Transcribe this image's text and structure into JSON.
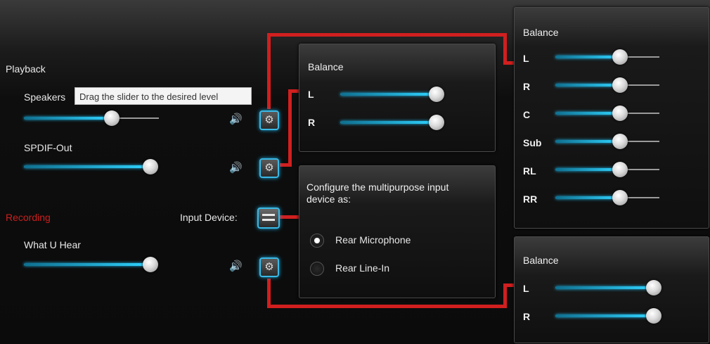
{
  "playback": {
    "title": "Playback",
    "devices": [
      {
        "label": "Speakers",
        "level": 0.65
      },
      {
        "label": "SPDIF-Out",
        "level": 1.0
      }
    ]
  },
  "recording": {
    "title": "Recording",
    "devices": [
      {
        "label": "What U Hear",
        "level": 1.0
      }
    ],
    "input_device_label": "Input Device:"
  },
  "tooltip": "Drag the slider to the desired level",
  "balance_small": {
    "title": "Balance",
    "channels": [
      {
        "label": "L",
        "level": 1.0
      },
      {
        "label": "R",
        "level": 1.0
      }
    ]
  },
  "balance_surround": {
    "title": "Balance",
    "channels": [
      {
        "label": "L",
        "level": 0.62
      },
      {
        "label": "R",
        "level": 0.62
      },
      {
        "label": "C",
        "level": 0.62
      },
      {
        "label": "Sub",
        "level": 0.62
      },
      {
        "label": "RL",
        "level": 0.62
      },
      {
        "label": "RR",
        "level": 0.62
      }
    ]
  },
  "balance_recording": {
    "title": "Balance",
    "channels": [
      {
        "label": "L",
        "level": 1.0
      },
      {
        "label": "R",
        "level": 1.0
      }
    ]
  },
  "input_config": {
    "prompt": "Configure the multipurpose input device as:",
    "options": [
      {
        "label": "Rear Microphone",
        "selected": true
      },
      {
        "label": "Rear Line-In",
        "selected": false
      }
    ]
  },
  "icons": {
    "gear": "gear-icon",
    "speaker": "speaker-icon",
    "input_device": "input-device-icon"
  },
  "colors": {
    "accent": "#2fd3ff",
    "connector": "#d11f1f",
    "recording_title": "#cc1f1f"
  }
}
